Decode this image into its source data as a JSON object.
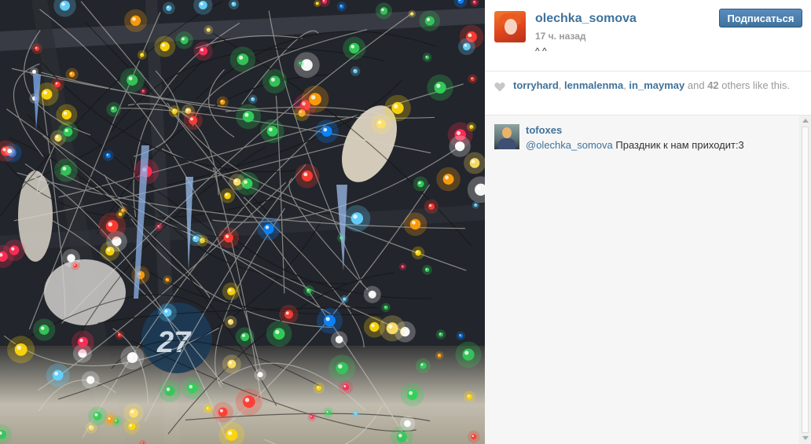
{
  "photo": {
    "label": "27"
  },
  "post": {
    "username": "olechka_somova",
    "time": "17 ч. назад",
    "caption": "^               ^",
    "follow_label": "Подписаться"
  },
  "likes": {
    "users": [
      "torryhard",
      "lenmalenma",
      "in_maymay"
    ],
    "and_word": "and",
    "count": "42",
    "suffix": "others like this."
  },
  "comments": [
    {
      "username": "tofoxes",
      "mention": "@olechka_somova",
      "text": "Праздник к нам приходит:3"
    }
  ],
  "colors": {
    "link": "#3f729b",
    "follow_bg": "#3f729b",
    "meta": "#999999"
  },
  "icons": [
    "heart-icon",
    "scroll-up-icon",
    "scroll-down-icon"
  ]
}
